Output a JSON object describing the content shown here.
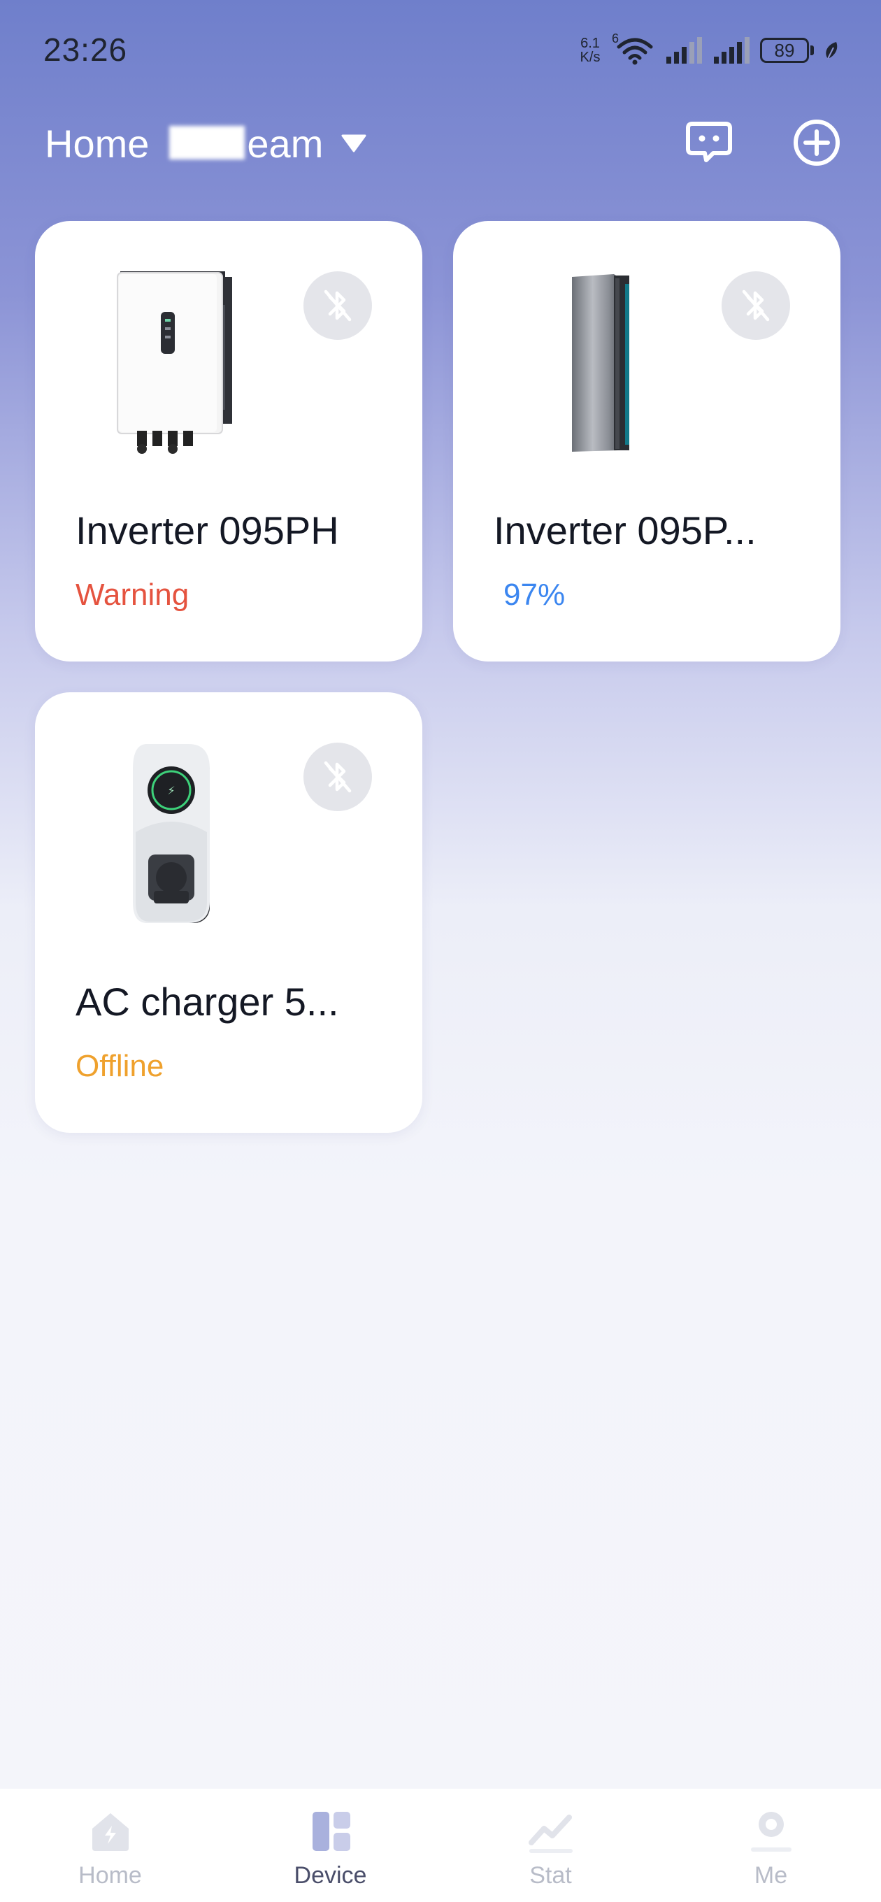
{
  "status_bar": {
    "time": "23:26",
    "net_speed_value": "6.1",
    "net_speed_unit": "K/s",
    "wifi_badge": "6",
    "battery": "89"
  },
  "header": {
    "home_name": "Home         eam",
    "icons": [
      "chat-icon",
      "add-circle-icon"
    ]
  },
  "devices": [
    {
      "name": "Inverter 095PH",
      "status": "Warning",
      "status_color": "#e5533f",
      "image": "wall-inverter"
    },
    {
      "name": "Inverter 095P...",
      "status": "97%",
      "status_color": "#3b86f0",
      "image": "battery-tower"
    },
    {
      "name": "AC charger 5...",
      "status": "Offline",
      "status_color": "#efa12d",
      "image": "ev-charger"
    }
  ],
  "nav": {
    "items": [
      {
        "label": "Home",
        "icon": "home-icon"
      },
      {
        "label": "Device",
        "icon": "device-icon"
      },
      {
        "label": "Stat",
        "icon": "stat-icon"
      },
      {
        "label": "Me",
        "icon": "me-icon"
      }
    ],
    "active": "Device"
  }
}
